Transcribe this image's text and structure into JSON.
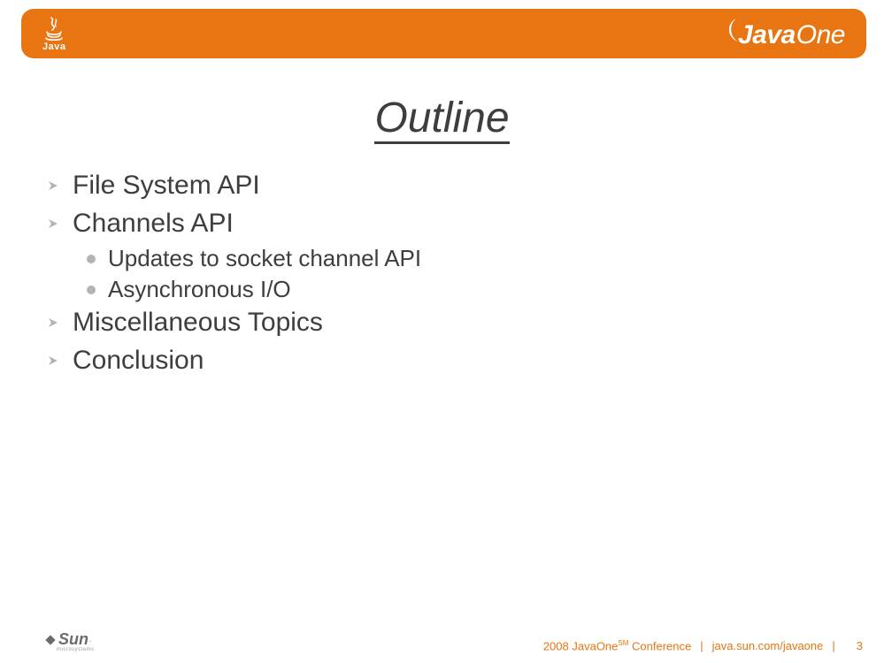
{
  "header": {
    "java_logo_text": "Java",
    "event_logo_java": "Java",
    "event_logo_one": "One"
  },
  "title": "Outline",
  "bullets": {
    "l1_0": "File System API",
    "l1_1": "Channels API",
    "l2_0": "Updates to socket channel API",
    "l2_1": "Asynchronous I/O",
    "l1_2": "Miscellaneous Topics",
    "l1_3": "Conclusion"
  },
  "footer": {
    "sun_text": "Sun",
    "sun_sub": "microsystems",
    "conf_prefix": "2008 JavaOne",
    "conf_sm": "SM",
    "conf_suffix": " Conference",
    "url": "java.sun.com/javaone",
    "sep": "|",
    "page": "3"
  }
}
